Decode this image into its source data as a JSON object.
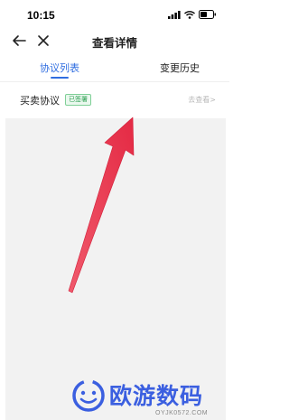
{
  "status_bar": {
    "time": "10:15"
  },
  "nav": {
    "title": "查看详情"
  },
  "tabs": [
    {
      "label": "协议列表",
      "active": true
    },
    {
      "label": "变更历史",
      "active": false
    }
  ],
  "agreement": {
    "title": "买卖协议",
    "badge": "已签署",
    "link": "去查看>"
  },
  "watermark": {
    "text": "欧游数码",
    "url": "OYJK0572.COM"
  },
  "icons": [
    "signal-icon",
    "wifi-icon",
    "battery-icon",
    "back-arrow-icon",
    "close-icon",
    "red-arrow-annotation"
  ],
  "colors": {
    "accent": "#2f6de0",
    "badge_green": "#2a9d4f",
    "arrow_red": "#e8314a",
    "watermark_blue": "#3b5fe0"
  }
}
